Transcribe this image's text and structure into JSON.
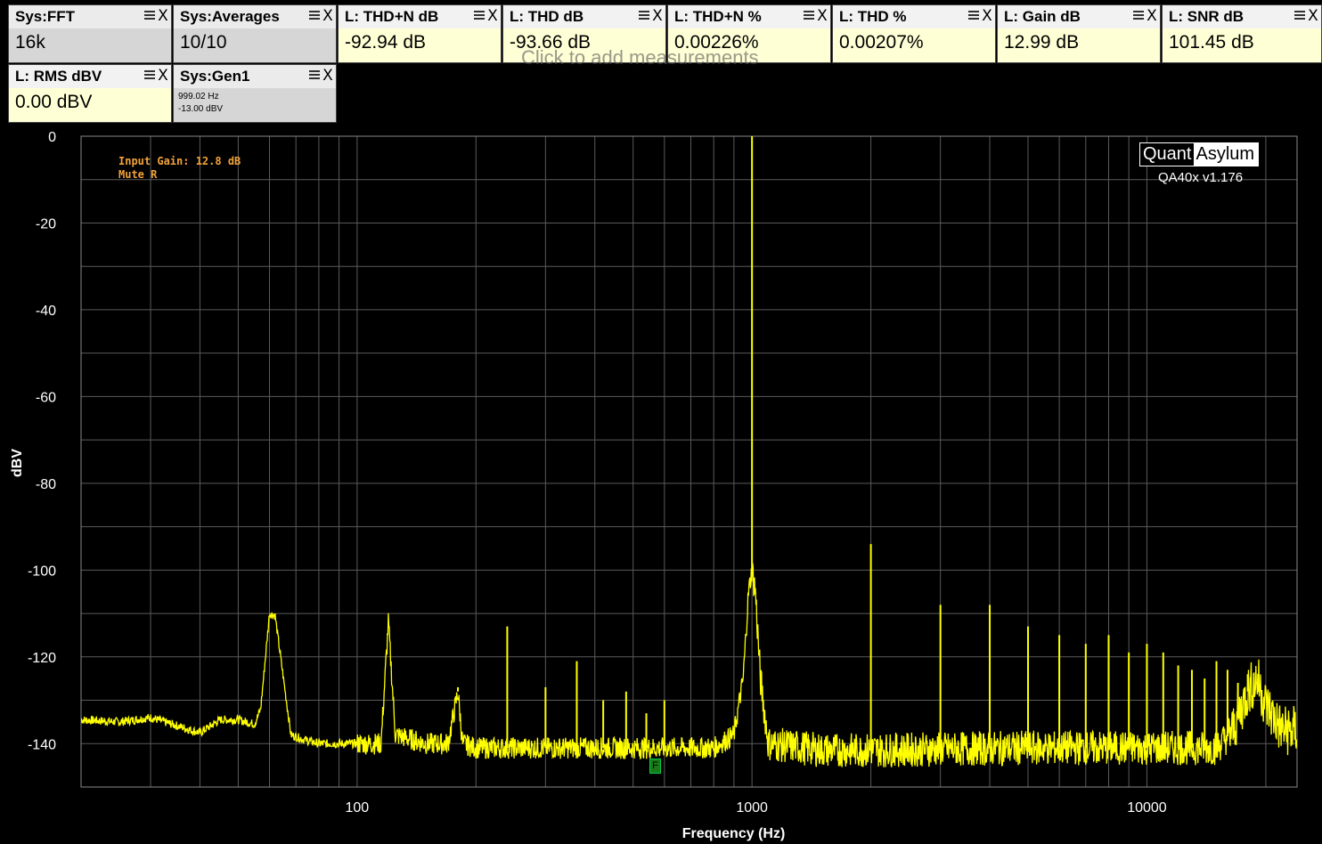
{
  "measurements": [
    {
      "title": "Sys:FFT",
      "value": "16k",
      "kind": "sys"
    },
    {
      "title": "Sys:Averages",
      "value": "10/10",
      "kind": "sys"
    },
    {
      "title": "L: THD+N dB",
      "value": "-92.94 dB",
      "kind": "lch"
    },
    {
      "title": "L: THD dB",
      "value": "-93.66 dB",
      "kind": "lch"
    },
    {
      "title": "L: THD+N %",
      "value": "0.00226%",
      "kind": "lch"
    },
    {
      "title": "L: THD %",
      "value": "0.00207%",
      "kind": "lch"
    },
    {
      "title": "L: Gain dB",
      "value": "12.99 dB",
      "kind": "lch"
    },
    {
      "title": "L: SNR dB",
      "value": "101.45 dB",
      "kind": "lch"
    },
    {
      "title": "L: RMS dBV",
      "value": "0.00 dBV",
      "kind": "lch"
    },
    {
      "title": "Sys:Gen1",
      "line1": "999.02 Hz",
      "line2": "-13.00 dBV",
      "kind": "sys"
    }
  ],
  "ghost_text": "Click to add measurements",
  "logo": {
    "left": "Quant",
    "right": "Asylum"
  },
  "version": "QA40x v1.176",
  "notes": [
    "Input Gain: 12.8 dB",
    "Mute R"
  ],
  "marker_label": "F",
  "icons": {
    "menu": "menu-icon",
    "close": "close-icon"
  },
  "chart_data": {
    "type": "line",
    "title": "",
    "xlabel": "Frequency (Hz)",
    "ylabel": "dBV",
    "x_scale": "log",
    "xlim": [
      20,
      24000
    ],
    "ylim": [
      -150,
      0
    ],
    "x_ticks": [
      100,
      1000,
      10000
    ],
    "y_ticks": [
      0,
      -20,
      -40,
      -60,
      -80,
      -100,
      -120,
      -140
    ],
    "grid": true,
    "line_color": "#ffff00",
    "series": [
      {
        "noise_floor_points": [
          [
            20,
            -134.5
          ],
          [
            25,
            -135
          ],
          [
            30,
            -134
          ],
          [
            40,
            -137.5
          ],
          [
            45,
            -134.5
          ],
          [
            50,
            -134.5
          ],
          [
            55,
            -135.5
          ],
          [
            57,
            -132
          ],
          [
            60,
            -110
          ],
          [
            62,
            -110.5
          ],
          [
            68,
            -138
          ],
          [
            73,
            -139
          ],
          [
            80,
            -140
          ],
          [
            90,
            -140
          ],
          [
            100,
            -140
          ],
          [
            115,
            -140
          ],
          [
            120,
            -112
          ],
          [
            125,
            -138
          ],
          [
            150,
            -140
          ],
          [
            170,
            -140
          ],
          [
            180,
            -128
          ],
          [
            185,
            -140
          ],
          [
            200,
            -141
          ],
          [
            240,
            -141
          ],
          [
            300,
            -141
          ],
          [
            400,
            -141
          ],
          [
            500,
            -141
          ],
          [
            600,
            -141
          ],
          [
            700,
            -141
          ],
          [
            800,
            -141
          ],
          [
            900,
            -138
          ],
          [
            950,
            -125
          ],
          [
            980,
            -105
          ],
          [
            1000,
            -100
          ],
          [
            1020,
            -105
          ],
          [
            1050,
            -125
          ],
          [
            1100,
            -140
          ],
          [
            1500,
            -141.5
          ],
          [
            2000,
            -141.5
          ],
          [
            5000,
            -141
          ],
          [
            10000,
            -141
          ],
          [
            15000,
            -141
          ],
          [
            16500,
            -137
          ],
          [
            18000,
            -128
          ],
          [
            19000,
            -125
          ],
          [
            20000,
            -131
          ],
          [
            22000,
            -137
          ],
          [
            24000,
            -137
          ]
        ],
        "peaks": [
          [
            60,
            -110
          ],
          [
            120,
            -112
          ],
          [
            180,
            -127
          ],
          [
            240,
            -113
          ],
          [
            300,
            -127
          ],
          [
            360,
            -121
          ],
          [
            420,
            -130
          ],
          [
            480,
            -128
          ],
          [
            540,
            -133
          ],
          [
            600,
            -130
          ],
          [
            1000,
            0
          ],
          [
            2000,
            -94
          ],
          [
            3000,
            -108
          ],
          [
            4000,
            -108
          ],
          [
            5000,
            -113
          ],
          [
            6000,
            -115
          ],
          [
            7000,
            -117
          ],
          [
            8000,
            -115
          ],
          [
            9000,
            -119
          ],
          [
            10000,
            -117
          ],
          [
            11000,
            -119
          ],
          [
            12000,
            -122
          ],
          [
            13000,
            -123
          ],
          [
            14000,
            -125
          ],
          [
            15000,
            -121
          ],
          [
            16000,
            -123
          ],
          [
            17000,
            -126
          ],
          [
            18000,
            -124
          ]
        ]
      }
    ]
  }
}
